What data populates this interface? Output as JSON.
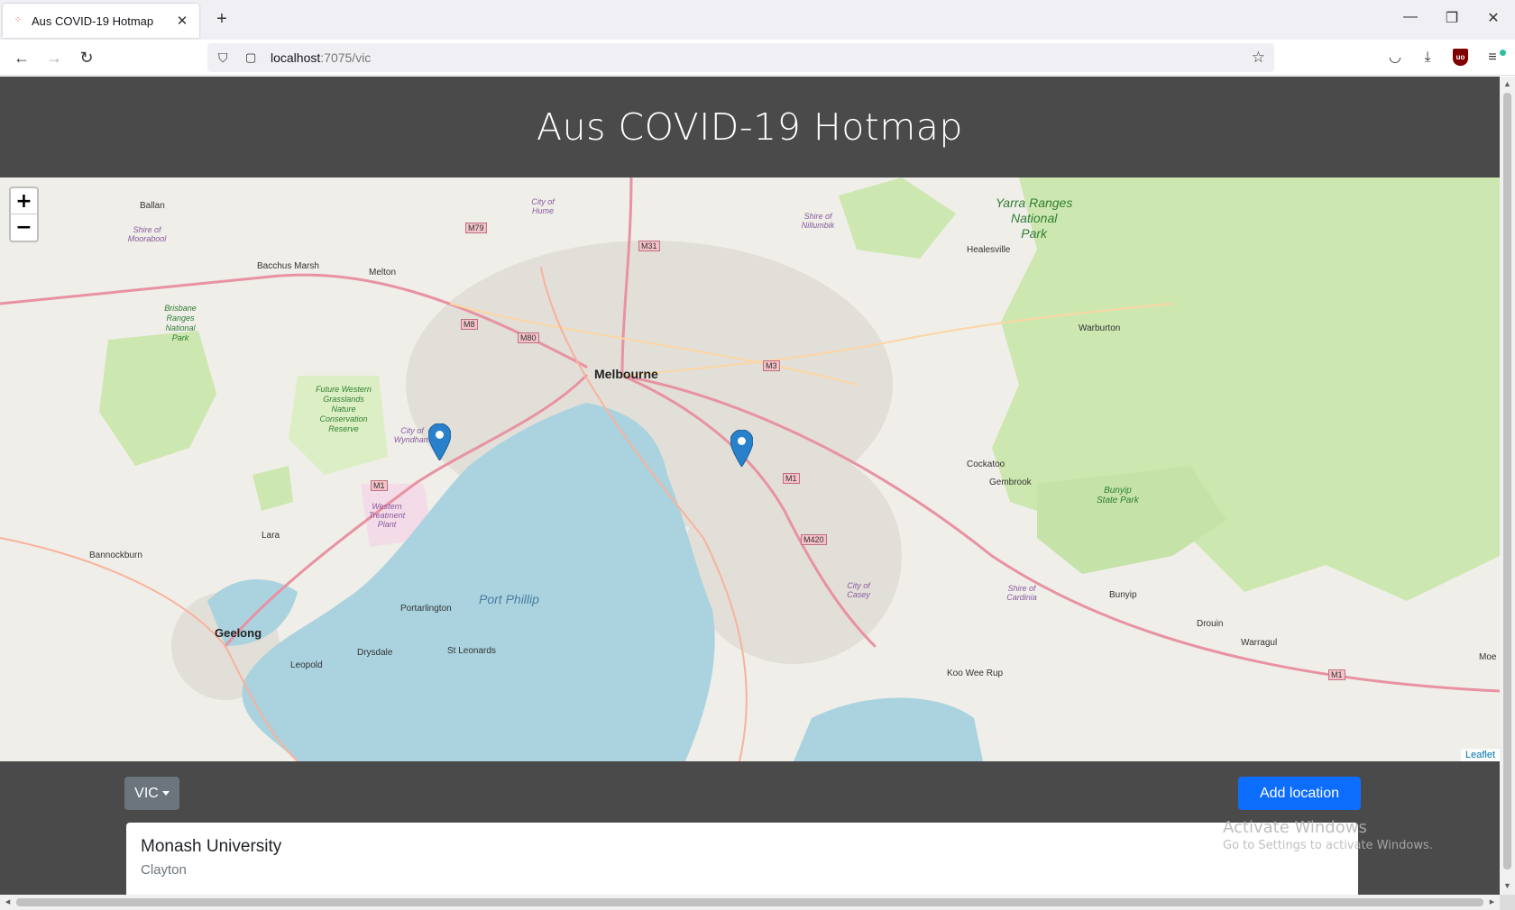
{
  "browser": {
    "tab_title": "Aus COVID-19 Hotmap",
    "url_host": "localhost",
    "url_path": ":7075/vic"
  },
  "page": {
    "title": "Aus COVID-19 Hotmap"
  },
  "map": {
    "zoom_in": "+",
    "zoom_out": "−",
    "attribution": "Leaflet",
    "labels": {
      "melbourne": "Melbourne",
      "geelong": "Geelong",
      "port_phillip": "Port Phillip",
      "ballan": "Ballan",
      "bacchus_marsh": "Bacchus Marsh",
      "melton": "Melton",
      "healesville": "Healesville",
      "warburton": "Warburton",
      "cockatoo": "Cockatoo",
      "gembrook": "Gembrook",
      "lara": "Lara",
      "bannockburn": "Bannockburn",
      "portarlington": "Portarlington",
      "drysdale": "Drysdale",
      "st_leonards": "St Leonards",
      "leopold": "Leopold",
      "koo_wee_rup": "Koo Wee Rup",
      "bunyip": "Bunyip",
      "drouin": "Drouin",
      "warragul": "Warragul",
      "moe": "Moe",
      "yarra_ranges": "Yarra Ranges",
      "national_park": "National",
      "park": "Park",
      "bunyip_sp": "Bunyip",
      "state_park": "State Park",
      "city_of_wyndham": "City of Wyndham",
      "city_of_casey": "City of Casey",
      "city_of_hume": "City of Hume",
      "shire_moorabool": "Shire of Moorabool",
      "shire_nillumbik": "Shire of Nillumbik",
      "shire_cardinia": "Shire of Cardinia",
      "brisbane_ranges": "Brisbane Ranges National Park",
      "future_grasslands": "Future Western Grasslands Nature Conservation Reserve",
      "western_treatment": "Western Treatment Plant",
      "m79": "M79",
      "m31": "M31",
      "m8": "M8",
      "m80": "M80",
      "m3": "M3",
      "m1a": "M1",
      "m1b": "M1",
      "m1c": "M1",
      "m420": "M420"
    }
  },
  "controls": {
    "state_select": "VIC",
    "add_button": "Add location"
  },
  "locations": [
    {
      "name": "Monash University",
      "suburb": "Clayton"
    }
  ],
  "os_watermark": {
    "line1": "Activate Windows",
    "line2": "Go to Settings to activate Windows."
  },
  "colors": {
    "primary": "#0d6efd",
    "secondary": "#6c757d",
    "header_bg": "#4a4a4a",
    "water": "#aad3df",
    "marker": "#2a81cb"
  }
}
